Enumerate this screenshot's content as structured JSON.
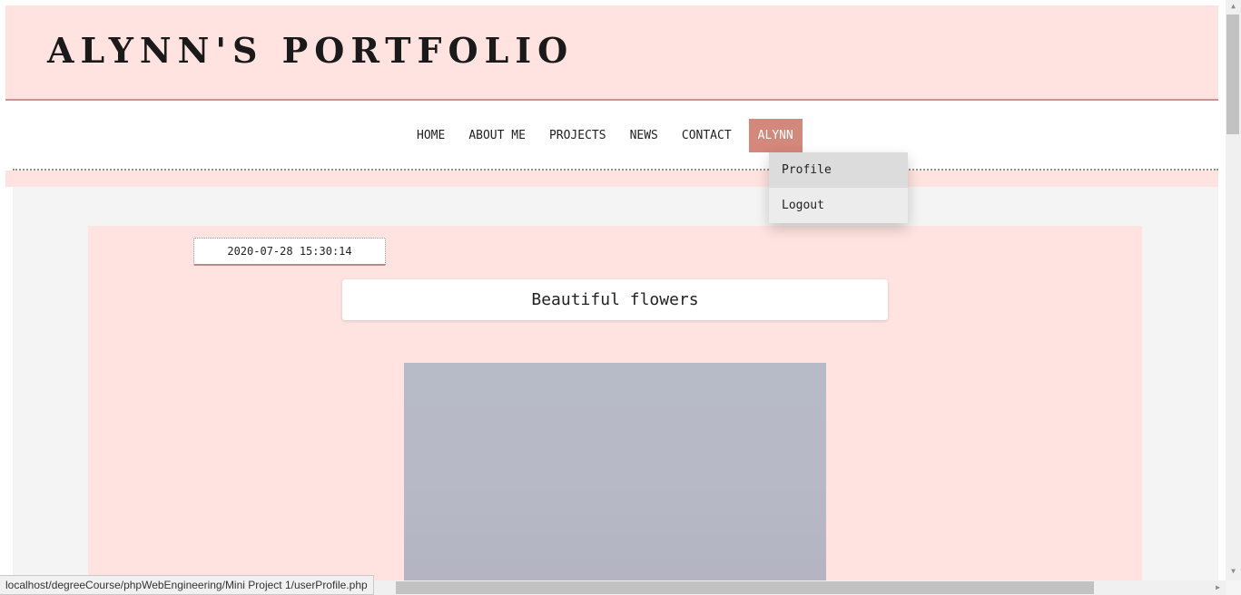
{
  "header": {
    "title": "ALYNN'S PORTFOLIO"
  },
  "nav": {
    "items": [
      {
        "label": "HOME"
      },
      {
        "label": "ABOUT ME"
      },
      {
        "label": "PROJECTS"
      },
      {
        "label": "NEWS"
      },
      {
        "label": "CONTACT"
      },
      {
        "label": "ALYNN"
      }
    ],
    "active_color": "#d4877b"
  },
  "dropdown": {
    "items": [
      {
        "label": "Profile"
      },
      {
        "label": "Logout"
      }
    ]
  },
  "post": {
    "date": "2020-07-28 15:30:14",
    "title": "Beautiful flowers"
  },
  "status_bar": {
    "url": "localhost/degreeCourse/phpWebEngineering/Mini Project 1/userProfile.php"
  },
  "colors": {
    "header_bg": "#ffe3e0",
    "content_bg": "#f4f4f4"
  }
}
